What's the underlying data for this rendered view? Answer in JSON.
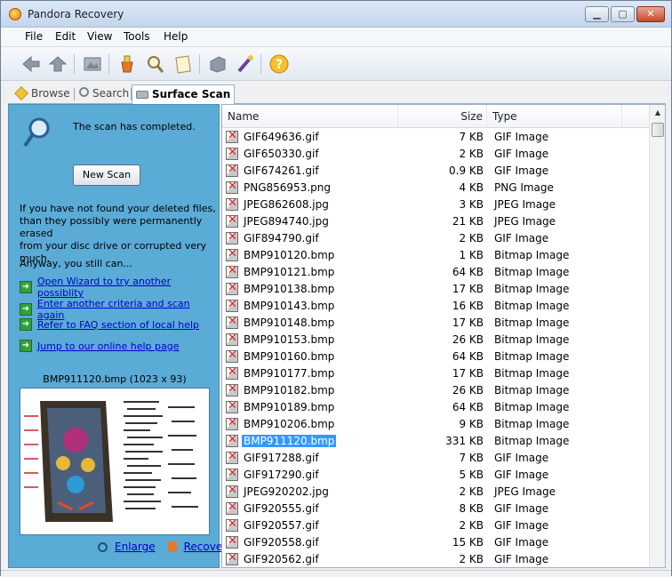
{
  "window": {
    "title": "Pandora Recovery"
  },
  "menu": {
    "items": [
      "File",
      "Edit",
      "View",
      "Tools",
      "Help"
    ]
  },
  "toolbar": {
    "icons": [
      "back-icon",
      "forward-icon",
      "picture-icon",
      "recover-icon",
      "search-icon",
      "notes-icon",
      "stack-icon",
      "wizard-icon",
      "help-icon"
    ]
  },
  "tabs": [
    {
      "label": "Browse",
      "icon": "browse-icon"
    },
    {
      "label": "Search",
      "icon": "search-icon"
    },
    {
      "label": "Surface Scan",
      "icon": "disk-icon",
      "active": true
    }
  ],
  "left": {
    "scan_message": "The scan has completed.",
    "new_scan_label": "New Scan",
    "info_lines": [
      "If you have not found your deleted files,",
      "than they possibly were permanently erased",
      "from your disc drive or corrupted very much."
    ],
    "still_text": "Anyway, you still can...",
    "links": [
      "Open Wizard to try another possiblity ",
      "Enter another criteria and scan again",
      "Refer to FAQ section of local help",
      "Jump to our online help page"
    ],
    "preview_caption": "BMP911120.bmp (1023 x 93)",
    "enlarge_label": "Enlarge",
    "recover_label": "Recover"
  },
  "filelist": {
    "columns": {
      "name": "Name",
      "size": "Size",
      "type": "Type"
    },
    "rows": [
      {
        "name": "GIF649636.gif",
        "size": "7 KB",
        "type": "GIF Image"
      },
      {
        "name": "GIF650330.gif",
        "size": "2 KB",
        "type": "GIF Image"
      },
      {
        "name": "GIF674261.gif",
        "size": "0.9 KB",
        "type": "GIF Image"
      },
      {
        "name": "PNG856953.png",
        "size": "4 KB",
        "type": "PNG Image"
      },
      {
        "name": "JPEG862608.jpg",
        "size": "3 KB",
        "type": "JPEG Image"
      },
      {
        "name": "JPEG894740.jpg",
        "size": "21 KB",
        "type": "JPEG Image"
      },
      {
        "name": "GIF894790.gif",
        "size": "2 KB",
        "type": "GIF Image"
      },
      {
        "name": "BMP910120.bmp",
        "size": "1 KB",
        "type": "Bitmap Image"
      },
      {
        "name": "BMP910121.bmp",
        "size": "64 KB",
        "type": "Bitmap Image"
      },
      {
        "name": "BMP910138.bmp",
        "size": "17 KB",
        "type": "Bitmap Image"
      },
      {
        "name": "BMP910143.bmp",
        "size": "16 KB",
        "type": "Bitmap Image"
      },
      {
        "name": "BMP910148.bmp",
        "size": "17 KB",
        "type": "Bitmap Image"
      },
      {
        "name": "BMP910153.bmp",
        "size": "26 KB",
        "type": "Bitmap Image"
      },
      {
        "name": "BMP910160.bmp",
        "size": "64 KB",
        "type": "Bitmap Image"
      },
      {
        "name": "BMP910177.bmp",
        "size": "17 KB",
        "type": "Bitmap Image"
      },
      {
        "name": "BMP910182.bmp",
        "size": "26 KB",
        "type": "Bitmap Image"
      },
      {
        "name": "BMP910189.bmp",
        "size": "64 KB",
        "type": "Bitmap Image"
      },
      {
        "name": "BMP910206.bmp",
        "size": "9 KB",
        "type": "Bitmap Image"
      },
      {
        "name": "BMP911120.bmp",
        "size": "331 KB",
        "type": "Bitmap Image",
        "selected": true
      },
      {
        "name": "GIF917288.gif",
        "size": "7 KB",
        "type": "GIF Image"
      },
      {
        "name": "GIF917290.gif",
        "size": "5 KB",
        "type": "GIF Image"
      },
      {
        "name": "JPEG920202.jpg",
        "size": "2 KB",
        "type": "JPEG Image"
      },
      {
        "name": "GIF920555.gif",
        "size": "8 KB",
        "type": "GIF Image"
      },
      {
        "name": "GIF920557.gif",
        "size": "2 KB",
        "type": "GIF Image"
      },
      {
        "name": "GIF920558.gif",
        "size": "15 KB",
        "type": "GIF Image"
      },
      {
        "name": "GIF920562.gif",
        "size": "2 KB",
        "type": "GIF Image"
      }
    ]
  },
  "colors": {
    "panel": "#5aabd6",
    "selection": "#3399ff",
    "link": "#0000d0"
  }
}
